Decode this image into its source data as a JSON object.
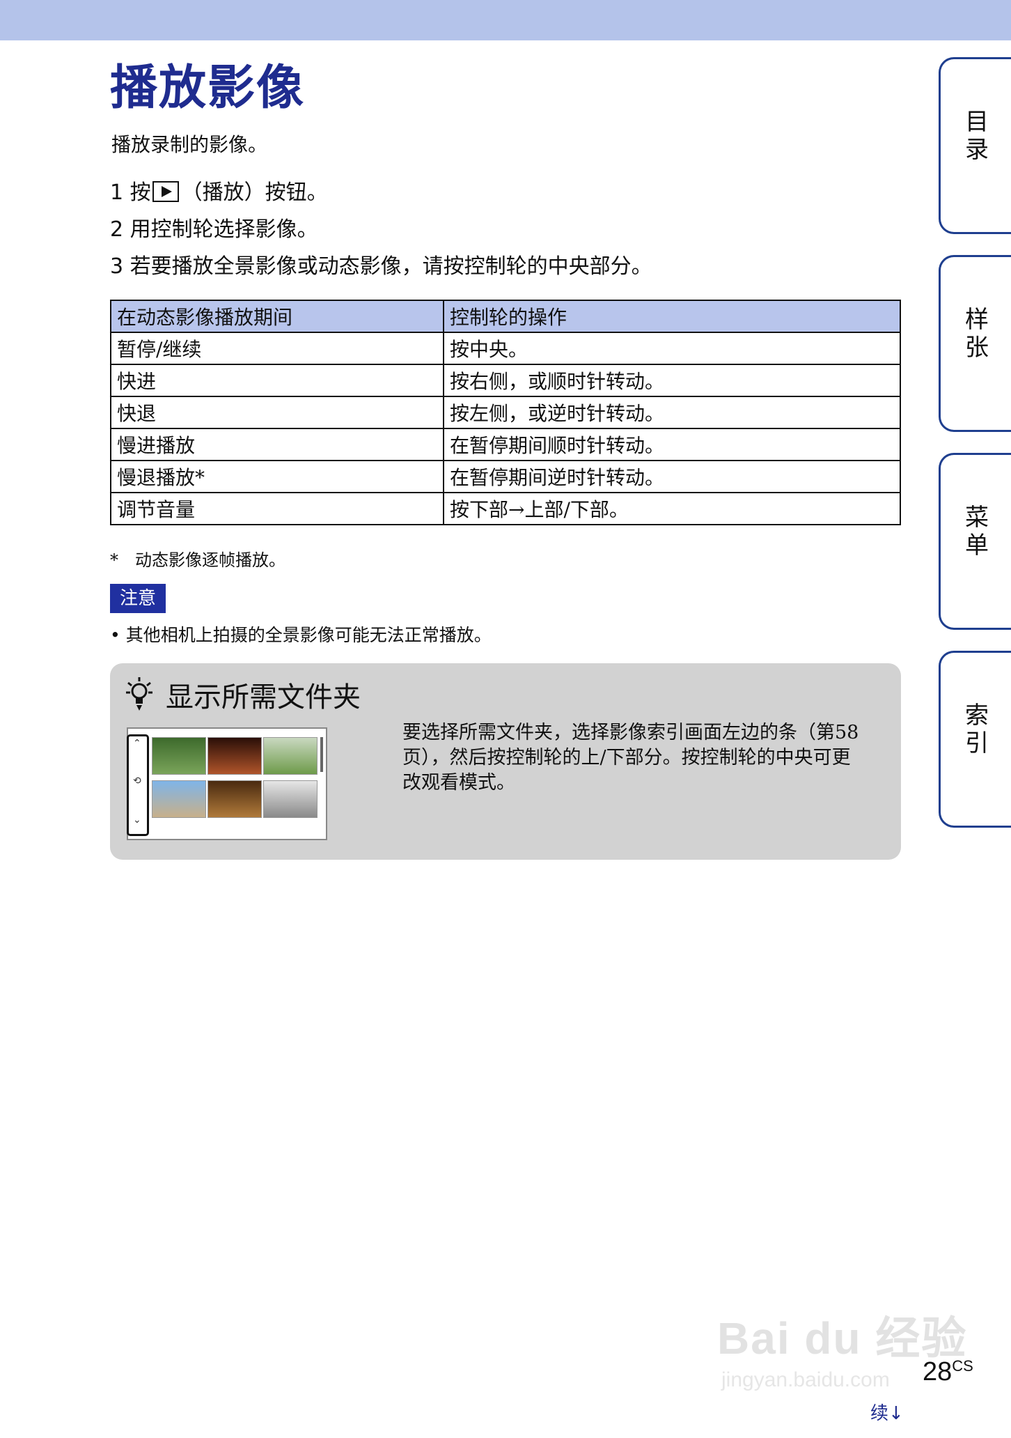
{
  "page": {
    "title": "播放影像",
    "intro": "播放录制的影像。",
    "steps": [
      {
        "num": "1",
        "before": "按",
        "after": "（播放）按钮。"
      },
      {
        "num": "2",
        "text": "用控制轮选择影像。"
      },
      {
        "num": "3",
        "text": "若要播放全景影像或动态影像，请按控制轮的中央部分。"
      }
    ],
    "table": {
      "headers": [
        "在动态影像播放期间",
        "控制轮的操作"
      ],
      "rows": [
        [
          "暂停/继续",
          "按中央。"
        ],
        [
          "快进",
          "按右侧，或顺时针转动。"
        ],
        [
          "快退",
          "按左侧，或逆时针转动。"
        ],
        [
          "慢进播放",
          "在暂停期间顺时针转动。"
        ],
        [
          "慢退播放*",
          "在暂停期间逆时针转动。"
        ],
        [
          "调节音量",
          "按下部→上部/下部。"
        ]
      ]
    },
    "footnote": "*　动态影像逐帧播放。",
    "note_label": "注意",
    "note_text": "•  其他相机上拍摄的全景影像可能无法正常播放。",
    "tip": {
      "title": "显示所需文件夹",
      "text": "要选择所需文件夹，选择影像索引画面左边的条（第58页），然后按控制轮的上/下部分。按控制轮的中央可更改观看模式。"
    },
    "side_tabs": [
      "目录",
      "样张",
      "菜单",
      "索引"
    ],
    "page_number": "28",
    "page_suffix": "CS",
    "continued": "续↓",
    "watermark": "Bai du 经验",
    "watermark_sub": "jingyan.baidu.com"
  },
  "colors": {
    "top_band": "#b4c3ea",
    "title": "#1f2c8f",
    "table_header": "#b8c5ec",
    "note_badge": "#2030a0",
    "tip_bg": "#d2d2d2",
    "tab_border": "#1f3f8f"
  },
  "icons": [
    "play-button-icon",
    "lightbulb-icon",
    "scroll-up-icon",
    "scroll-down-icon",
    "folder-switch-icon"
  ]
}
